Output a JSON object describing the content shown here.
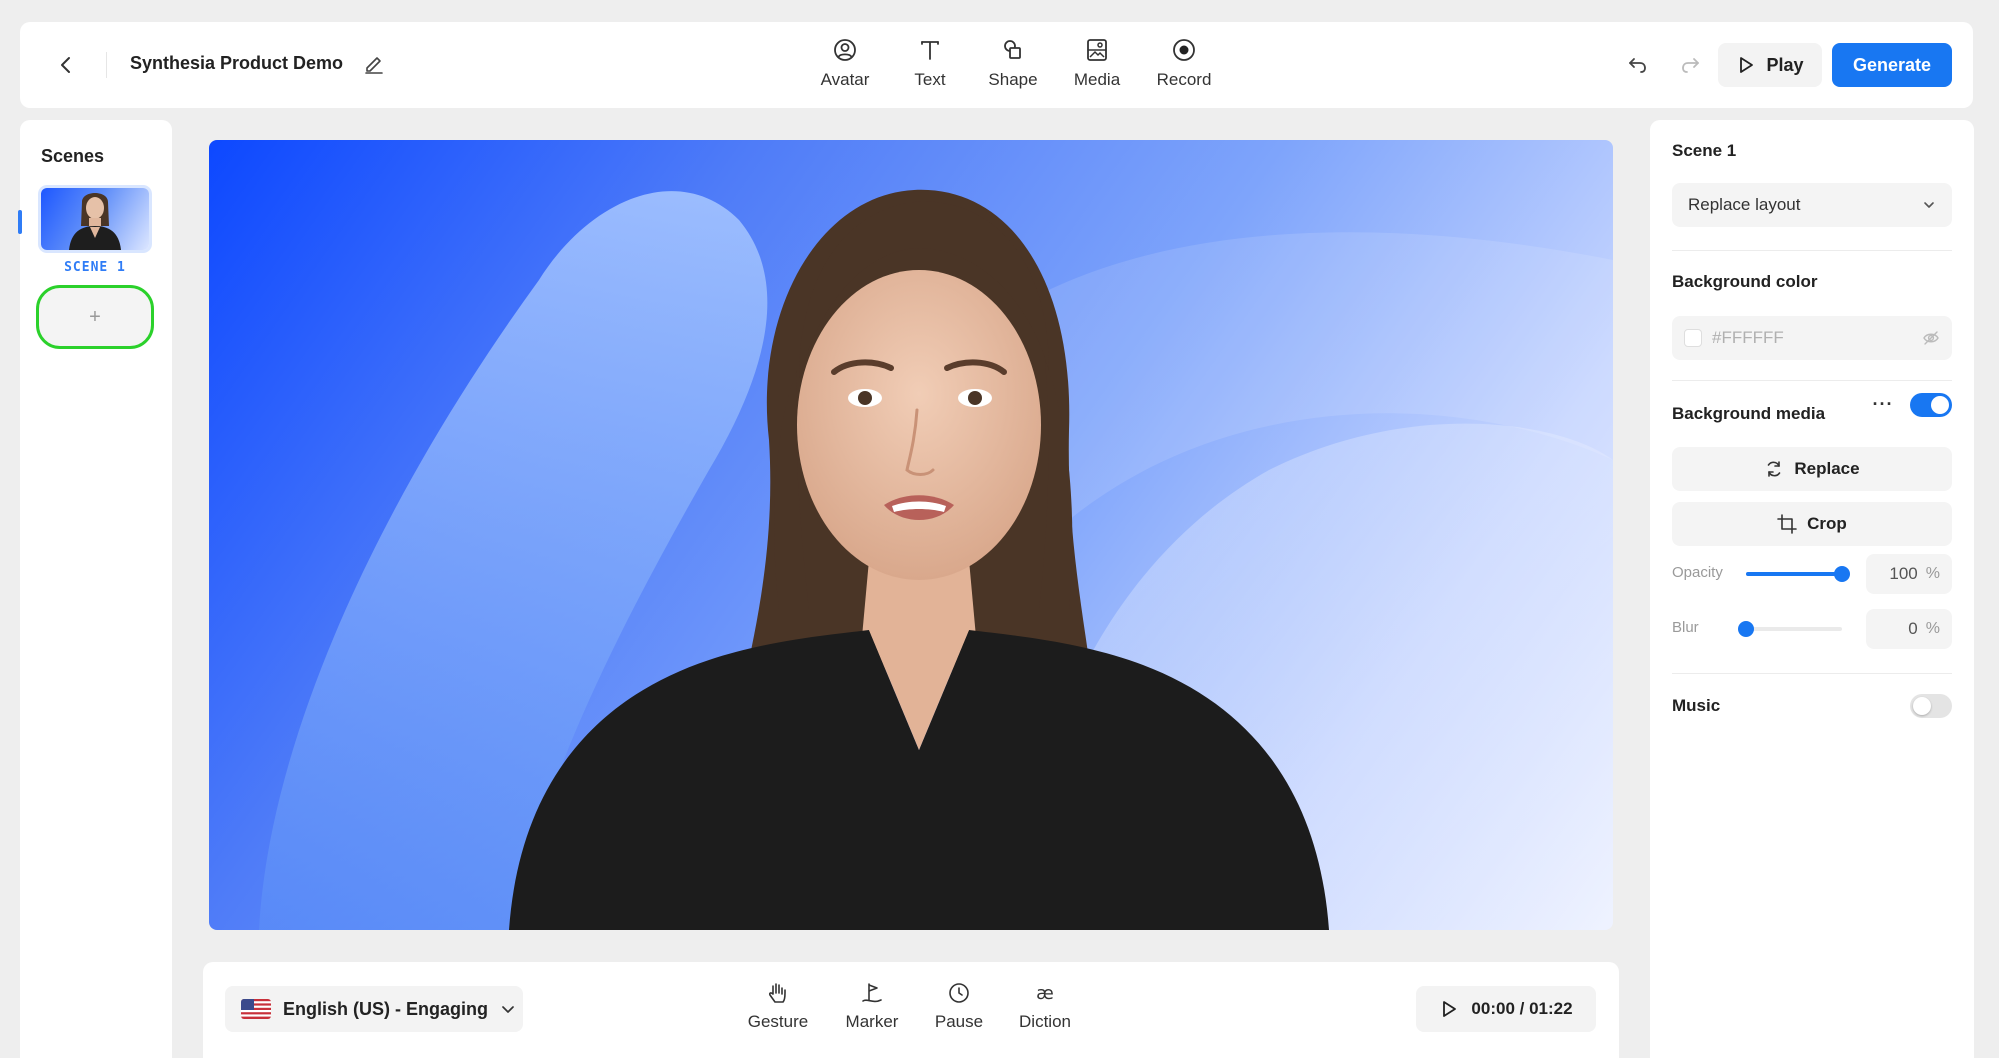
{
  "header": {
    "project_title": "Synthesia Product Demo",
    "tools": [
      {
        "label": "Avatar",
        "icon": "avatar-icon"
      },
      {
        "label": "Text",
        "icon": "text-icon"
      },
      {
        "label": "Shape",
        "icon": "shape-icon"
      },
      {
        "label": "Media",
        "icon": "media-icon"
      },
      {
        "label": "Record",
        "icon": "record-icon"
      }
    ],
    "play_label": "Play",
    "generate_label": "Generate"
  },
  "scenes": {
    "title": "Scenes",
    "items": [
      {
        "label": "SCENE 1",
        "selected": true
      }
    ],
    "add_label": "+"
  },
  "bottom_bar": {
    "language": "English (US) - Engaging",
    "tools": [
      {
        "label": "Gesture",
        "icon": "gesture-icon"
      },
      {
        "label": "Marker",
        "icon": "marker-icon"
      },
      {
        "label": "Pause",
        "icon": "pause-clock-icon"
      },
      {
        "label": "Diction",
        "icon": "diction-icon"
      }
    ],
    "timecode": "00:00 / 01:22"
  },
  "properties": {
    "scene_title": "Scene 1",
    "layout_select": "Replace layout",
    "background_color_label": "Background color",
    "background_color_value": "#FFFFFF",
    "background_media_label": "Background media",
    "background_media_enabled": true,
    "replace_label": "Replace",
    "crop_label": "Crop",
    "opacity_label": "Opacity",
    "opacity_value": "100",
    "opacity_fraction": 1.0,
    "blur_label": "Blur",
    "blur_value": "0",
    "blur_fraction": 0.0,
    "unit": "%",
    "music_label": "Music",
    "music_enabled": false
  },
  "colors": {
    "accent": "#1877f2",
    "scene_label": "#2f7cf6",
    "highlight_ring": "#2bd12b"
  }
}
